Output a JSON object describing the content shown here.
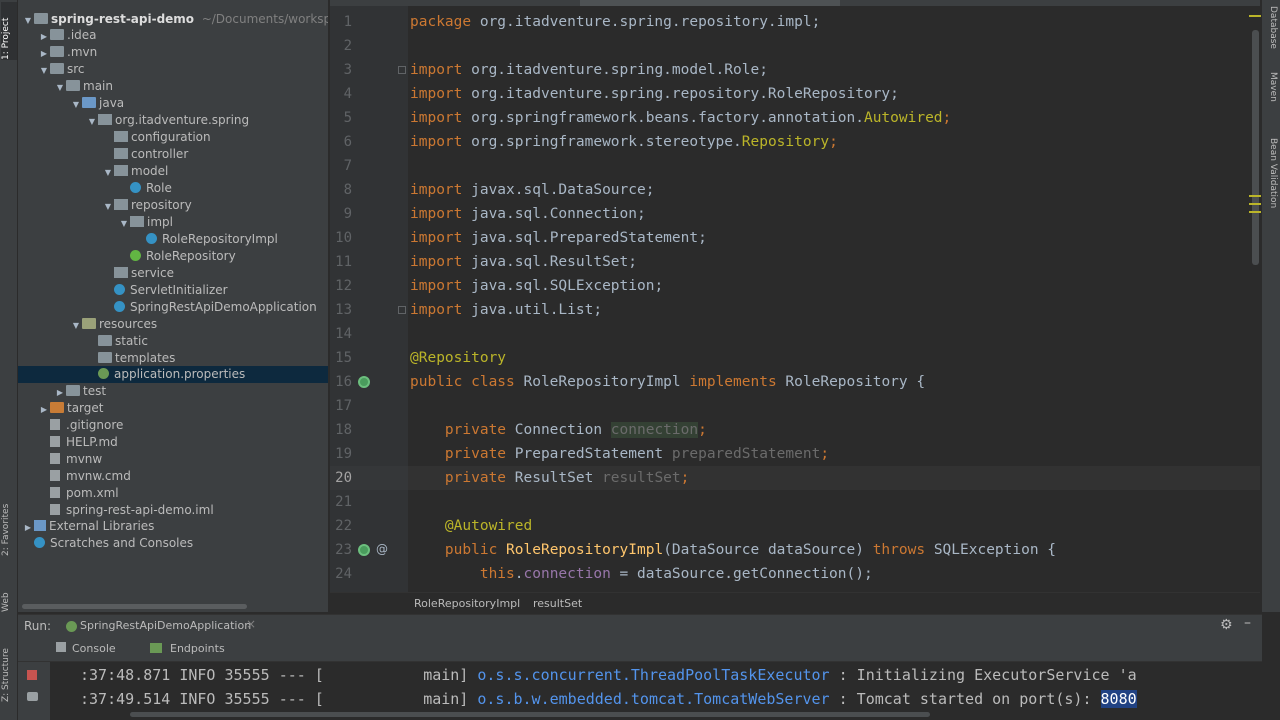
{
  "left_stripe": {
    "project_tab": "1: Project",
    "favorites_tab": "2: Favorites",
    "web_tab": "Web",
    "structure_tab": "Z: Structure"
  },
  "right_stripe": {
    "database_tab": "Database",
    "maven_tab": "Maven",
    "bean_validation_tab": "Bean Validation"
  },
  "project_tree": {
    "root_name": "spring-rest-api-demo",
    "root_path": "~/Documents/workspace",
    "items": [
      {
        "label": "spring-rest-api-demo",
        "level": 0
      },
      {
        "label": ".idea",
        "level": 1
      },
      {
        "label": ".mvn",
        "level": 1
      },
      {
        "label": "src",
        "level": 1
      },
      {
        "label": "main",
        "level": 2
      },
      {
        "label": "java",
        "level": 3
      },
      {
        "label": "org.itadventure.spring",
        "level": 4
      },
      {
        "label": "configuration",
        "level": 5
      },
      {
        "label": "controller",
        "level": 5
      },
      {
        "label": "model",
        "level": 5
      },
      {
        "label": "Role",
        "level": 6
      },
      {
        "label": "repository",
        "level": 5
      },
      {
        "label": "impl",
        "level": 6
      },
      {
        "label": "RoleRepositoryImpl",
        "level": 7
      },
      {
        "label": "RoleRepository",
        "level": 6
      },
      {
        "label": "service",
        "level": 5
      },
      {
        "label": "ServletInitializer",
        "level": 5
      },
      {
        "label": "SpringRestApiDemoApplication",
        "level": 5
      },
      {
        "label": "resources",
        "level": 3
      },
      {
        "label": "static",
        "level": 4
      },
      {
        "label": "templates",
        "level": 4
      },
      {
        "label": "application.properties",
        "level": 4
      },
      {
        "label": "test",
        "level": 2
      },
      {
        "label": "target",
        "level": 1
      },
      {
        "label": ".gitignore",
        "level": 1
      },
      {
        "label": "HELP.md",
        "level": 1
      },
      {
        "label": "mvnw",
        "level": 1
      },
      {
        "label": "mvnw.cmd",
        "level": 1
      },
      {
        "label": "pom.xml",
        "level": 1
      },
      {
        "label": "spring-rest-api-demo.iml",
        "level": 1
      },
      {
        "label": "External Libraries",
        "level": 0
      },
      {
        "label": "Scratches and Consoles",
        "level": 0
      }
    ]
  },
  "editor": {
    "current_line": "20",
    "line_numbers": [
      "1",
      "2",
      "3",
      "4",
      "5",
      "6",
      "7",
      "8",
      "9",
      "10",
      "11",
      "12",
      "13",
      "14",
      "15",
      "16",
      "17",
      "18",
      "19",
      "20",
      "21",
      "22",
      "23",
      "24"
    ],
    "lines": {
      "l1_kw": "package",
      "l1_rest": " org.itadventure.spring.repository.impl;",
      "l3_kw": "import",
      "l3_rest": " org.itadventure.spring.model.Role;",
      "l4_kw": "import",
      "l4_rest": " org.itadventure.spring.repository.RoleRepository;",
      "l5_kw": "import",
      "l5_rest": " org.springframework.beans.factory.annotation.",
      "l5_ann": "Autowired",
      "l5_end": ";",
      "l6_kw": "import",
      "l6_rest": " org.springframework.stereotype.",
      "l6_ann": "Repository",
      "l6_end": ";",
      "l8_kw": "import",
      "l8_rest": " javax.sql.DataSource;",
      "l9_kw": "import",
      "l9_rest": " java.sql.Connection;",
      "l10_kw": "import",
      "l10_rest": " java.sql.PreparedStatement;",
      "l11_kw": "import",
      "l11_rest": " java.sql.ResultSet;",
      "l12_kw": "import",
      "l12_rest": " java.sql.SQLException;",
      "l13_kw": "import",
      "l13_rest": " java.util.List;",
      "l15_ann": "@Repository",
      "l16_kw1": "public class",
      "l16_name": " RoleRepositoryImpl ",
      "l16_kw2": "implements",
      "l16_rest": " RoleRepository {",
      "l18_kw": "    private",
      "l18_type": " Connection ",
      "l18_var": "connection",
      "l18_end": ";",
      "l19_kw": "    private",
      "l19_type": " PreparedStatement ",
      "l19_var": "preparedStatement",
      "l19_end": ";",
      "l20_kw": "    private",
      "l20_type": " ResultSet ",
      "l20_var": "resultSet",
      "l20_end": ";",
      "l22_ann": "    @Autowired",
      "l23_kw": "    public",
      "l23_fn": " RoleRepositoryImpl",
      "l23_mid": "(DataSource dataSource) ",
      "l23_kw2": "throws",
      "l23_rest": " SQLException {",
      "l24_kw": "        this",
      "l24_dot": ".",
      "l24_fld": "connection",
      "l24_rest": " = dataSource.getConnection();"
    }
  },
  "breadcrumb": {
    "class_name": "RoleRepositoryImpl",
    "member_name": "resultSet"
  },
  "run_panel": {
    "run_label": "Run:",
    "config_name": "SpringRestApiDemoApplication",
    "close_symbol": "×",
    "console_tab": "Console",
    "endpoints_tab": "Endpoints",
    "log_lines": [
      {
        "time": ":37:48.871",
        "level": "INFO",
        "pid": "35555",
        "sep": "--- [",
        "thread": "main]",
        "logger": "o.s.s.concurrent.ThreadPoolTaskExecutor",
        "message": " : Initializing ExecutorService 'a"
      },
      {
        "time": ":37:49.514",
        "level": "INFO",
        "pid": "35555",
        "sep": "--- [",
        "thread": "main]",
        "logger": "o.s.b.w.embedded.tomcat.TomcatWebServer",
        "message": " : Tomcat started on port(s): ",
        "port": "8080"
      }
    ]
  },
  "colors": {
    "keyword": "#cc7832",
    "annotation": "#bbb529",
    "field": "#9876aa",
    "method": "#ffc66d",
    "logger": "#5394ec",
    "selection": "#0d293e"
  }
}
